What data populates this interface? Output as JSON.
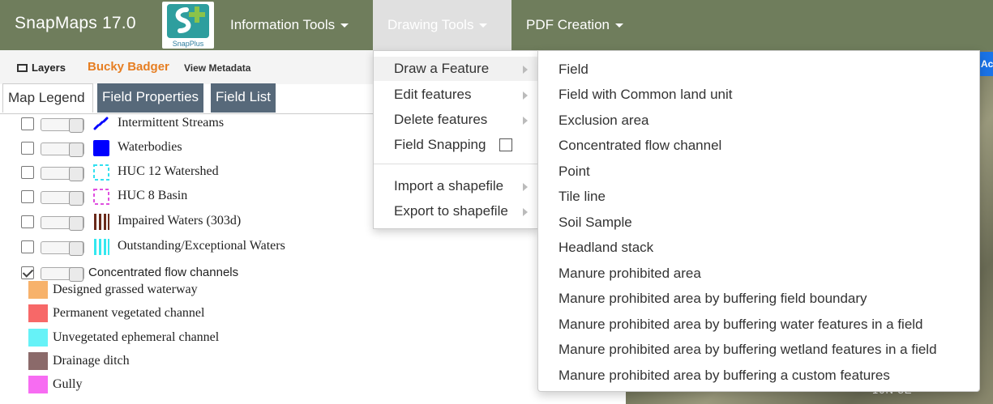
{
  "app": {
    "title": "SnapMaps 17.0",
    "logo_text": "SnapPlus",
    "nav": [
      {
        "label": "Information Tools"
      },
      {
        "label": "Drawing Tools"
      },
      {
        "label": "PDF Creation"
      }
    ]
  },
  "panel": {
    "layers_label": "Layers",
    "user_name": "Bucky Badger",
    "metadata_label": "View Metadata",
    "tabs": [
      "Map Legend",
      "Field Properties",
      "Field List"
    ],
    "layers": [
      {
        "label": "Intermittent Streams",
        "checked": false
      },
      {
        "label": "Waterbodies",
        "checked": false
      },
      {
        "label": "HUC 12 Watershed",
        "checked": false
      },
      {
        "label": "HUC 8 Basin",
        "checked": false
      },
      {
        "label": "Impaired Waters (303d)",
        "checked": false
      },
      {
        "label": "Outstanding/Exceptional Waters",
        "checked": false
      },
      {
        "label": "Concentrated flow channels",
        "checked": true
      }
    ],
    "flow_channel_legend": [
      {
        "label": "Designed grassed waterway",
        "color": "#f7b26b"
      },
      {
        "label": "Permanent vegetated channel",
        "color": "#f76868"
      },
      {
        "label": "Unvegetated ephemeral channel",
        "color": "#66f2f7"
      },
      {
        "label": "Drainage ditch",
        "color": "#8b6a6a"
      },
      {
        "label": "Gully",
        "color": "#f76cf2"
      }
    ]
  },
  "drawing_menu": {
    "items": [
      {
        "label": "Draw a Feature",
        "submenu": true
      },
      {
        "label": "Edit features",
        "submenu": true
      },
      {
        "label": "Delete features",
        "submenu": true
      },
      {
        "label": "Field Snapping",
        "checkbox": true,
        "checked": false
      },
      {
        "label": "Import a shapefile",
        "submenu": true
      },
      {
        "label": "Export to shapefile",
        "submenu": true
      }
    ]
  },
  "feature_menu": {
    "items": [
      "Field",
      "Field with Common land unit",
      "Exclusion area",
      "Concentrated flow channel",
      "Point",
      "Tile line",
      "Soil Sample",
      "Headland stack",
      "Manure prohibited area",
      "Manure prohibited area by buffering field boundary",
      "Manure prohibited area by buffering water features in a field",
      "Manure prohibited area by buffering wetland features in a field",
      "Manure prohibited area by buffering a custom features"
    ]
  },
  "map": {
    "button_label": "Ac",
    "label": "10N 8E"
  },
  "colors": {
    "navbar": "#6f7d5c",
    "accent_user": "#e67e22",
    "tab_inactive": "#57697a",
    "map_button": "#1a73e8"
  }
}
